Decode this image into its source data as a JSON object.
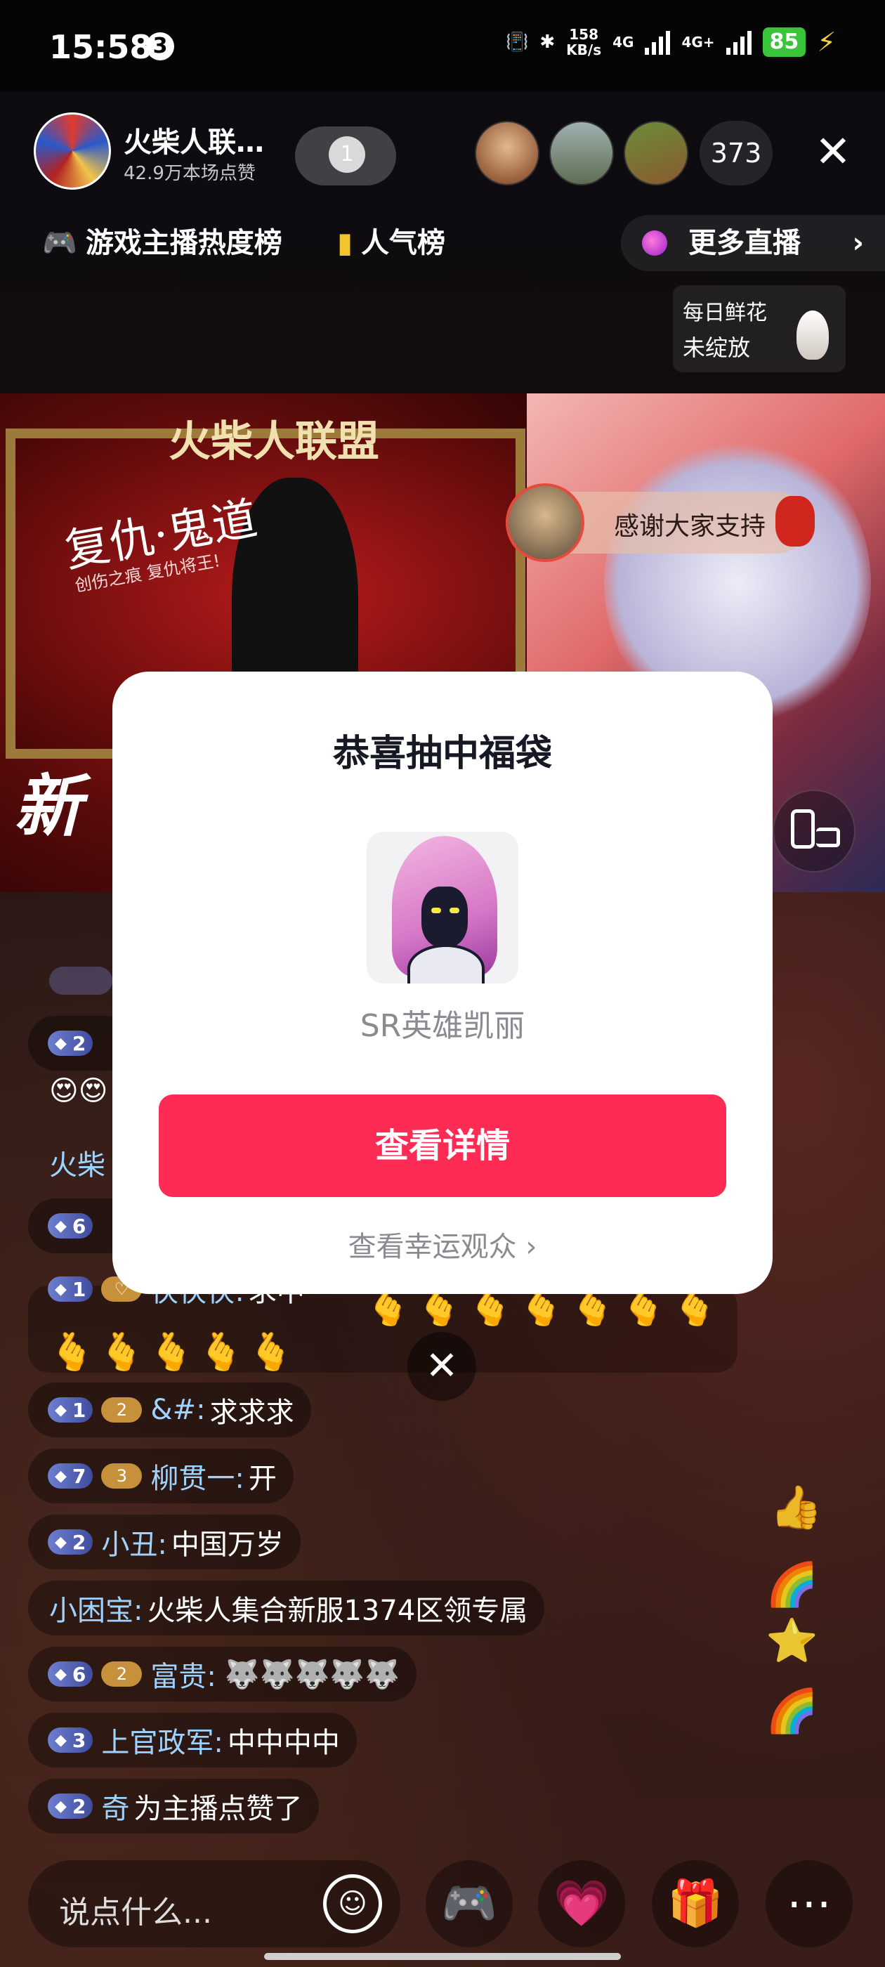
{
  "status_bar": {
    "time": "15:58",
    "notification_count": "3",
    "net_speed_value": "158",
    "net_speed_unit": "KB/s",
    "network1": "4G",
    "network2": "4G+",
    "battery": "85"
  },
  "host": {
    "name": "火柴人联…",
    "likes": "42.9万本场点赞",
    "follow_level": "1",
    "viewer_count": "373"
  },
  "ranks": {
    "game_rank": "游戏主播热度榜",
    "popularity_rank": "人气榜",
    "more_live": "更多直播"
  },
  "flower": {
    "line1": "每日鲜花",
    "line2": "未绽放"
  },
  "video": {
    "game_title": "火柴人联盟",
    "slogan": "复仇·鬼道",
    "slogan_sub": "创伤之痕 复仇将王!",
    "banner_text": "新",
    "thanks_text": "感谢大家支持"
  },
  "chat": [
    {
      "level": "2",
      "fan": "",
      "user": "",
      "text": "😍😍"
    },
    {
      "level": "",
      "fan": "",
      "user": "火柴",
      "text": ""
    },
    {
      "level": "6",
      "fan": "",
      "user": "",
      "text": ""
    },
    {
      "level": "1",
      "fan": "",
      "user": "茯茯茯:",
      "text": "求中",
      "emoji": "🫰🫰🫰🫰🫰🫰🫰",
      "emoji2": "🫰🫰🫰🫰🫰"
    },
    {
      "level": "1",
      "fan": "2",
      "user": "&#:",
      "text": "求求求"
    },
    {
      "level": "7",
      "fan": "3",
      "user": "柳贯一:",
      "text": "开"
    },
    {
      "level": "2",
      "fan": "",
      "user": "小丑:",
      "text": "中国万岁"
    },
    {
      "level": "",
      "fan": "",
      "user": "小困宝:",
      "text": "火柴人集合新服1374区领专属"
    },
    {
      "level": "6",
      "fan": "2",
      "user": "富贵:",
      "text": "",
      "emoji": "🐺🐺🐺🐺🐺"
    },
    {
      "level": "3",
      "fan": "",
      "user": "上官政军:",
      "text": "中中中中"
    },
    {
      "level": "2",
      "fan": "",
      "user": "奇",
      "text": "为主播点赞了"
    }
  ],
  "bottom_bar": {
    "input_placeholder": "说点什么..."
  },
  "modal": {
    "title": "恭喜抽中福袋",
    "prize_name": "SR英雄凯丽",
    "detail_button": "查看详情",
    "lucky_link": "查看幸运观众 ›"
  },
  "colors": {
    "accent": "#fe2c55",
    "level_badge": "#5866c0",
    "username": "#9fd3ff"
  }
}
